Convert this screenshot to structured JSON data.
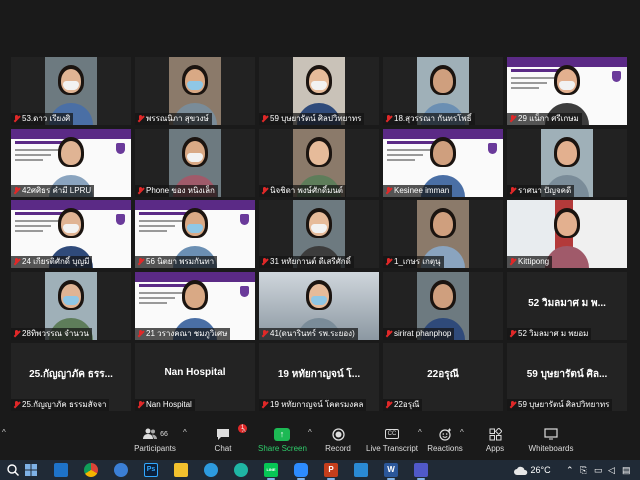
{
  "tiles": [
    {
      "name": "53.ดาว เรียงศิ",
      "big": ""
    },
    {
      "name": "พรรณนิภา สุขวงษ์",
      "big": ""
    },
    {
      "name": "59 บุษยารัตน์ ศิลปวิทยาทร",
      "big": ""
    },
    {
      "name": "18.สุวรรณา กันทรโพธิ์",
      "big": ""
    },
    {
      "name": "29 แน็กา ศรีเกษม",
      "big": ""
    },
    {
      "name": "42ศศิธร คำมี LPRU",
      "big": ""
    },
    {
      "name": "Phone ของ หนิงเล็ก",
      "big": ""
    },
    {
      "name": "นิจชิดา พงษ์ศักดิ์มนต์",
      "big": ""
    },
    {
      "name": "Kesinee imman",
      "big": ""
    },
    {
      "name": "ราศนา ปัญจคดี",
      "big": ""
    },
    {
      "name": "24 เกียรติศักดิ์ บุญมี",
      "big": ""
    },
    {
      "name": "56 นิตยา พรมกันทา",
      "big": ""
    },
    {
      "name": "31 หทัยกานต์ ดีเสรีศักดิ์",
      "big": ""
    },
    {
      "name": "1_เกษร เกตุนุ",
      "big": ""
    },
    {
      "name": "Kittipong",
      "big": ""
    },
    {
      "name": "28ทิพวรรณ จำนวน",
      "big": ""
    },
    {
      "name": "21 วรางคณา ชมภูวิเศษ",
      "big": ""
    },
    {
      "name": "41(ดนารินทร์ รพ.ระยอง)",
      "big": ""
    },
    {
      "name": "sirirat phanphop",
      "big": ""
    },
    {
      "name": "52 วิมลมาศ ม พยอม",
      "big": "52 วิมลมาศ ม พ..."
    },
    {
      "name": "25.กัญญาภัค ธรรมสัจจา",
      "big": "25.กัญญาภัค ธรร..."
    },
    {
      "name": "Nan Hospital",
      "big": "Nan Hospital"
    },
    {
      "name": "19 หทัยกาญจน์ โคตรมงคล",
      "big": "19 หทัยกาญจน์ โ..."
    },
    {
      "name": "22อรุณี",
      "big": "22อรุณี"
    },
    {
      "name": "59 บุษยารัตน์ ศิลปวิทยาทร",
      "big": "59 บุษยารัตน์ ศิล..."
    }
  ],
  "toolbar": {
    "participants": {
      "label": "Participants",
      "count": "66"
    },
    "chat": {
      "label": "Chat",
      "badge": "1"
    },
    "share": {
      "label": "Share Screen"
    },
    "record": {
      "label": "Record"
    },
    "transcript": {
      "label": "Live Transcript",
      "icon_text": "CC"
    },
    "reactions": {
      "label": "Reactions"
    },
    "apps": {
      "label": "Apps"
    },
    "whiteboards": {
      "label": "Whiteboards"
    },
    "caret": "^"
  },
  "taskbar": {
    "temperature": "26°C",
    "apps": [
      "start-icon",
      "mail-icon",
      "chrome-icon",
      "globe-icon",
      "photoshop-icon",
      "file-explorer-icon",
      "edge-icon",
      "edge-icon",
      "line-icon",
      "zoom-icon",
      "powerpoint-icon",
      "photos-icon",
      "word-icon",
      "teams-icon"
    ],
    "app_text": {
      "photoshop": "Ps",
      "powerpoint": "P",
      "word": "W",
      "line": "LINE"
    }
  },
  "colors": {
    "mic_off": "#e02828",
    "share": "#1db954",
    "slide_purple": "#5b2a86",
    "background": "#1a1a1a",
    "taskbar": "#202a36"
  }
}
